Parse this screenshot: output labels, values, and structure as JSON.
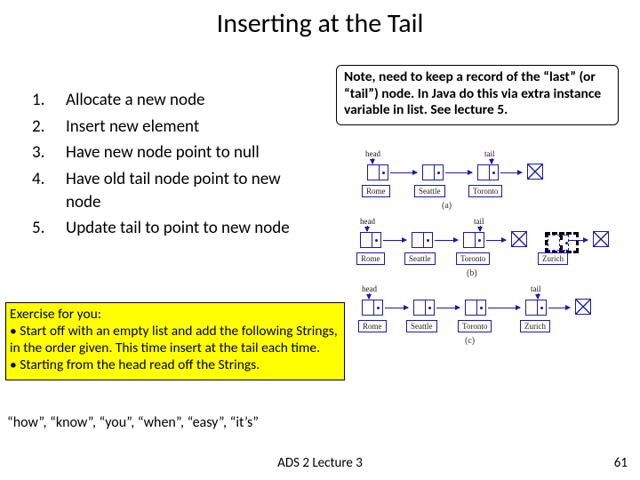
{
  "title": "Inserting at the Tail",
  "steps": [
    {
      "n": "1.",
      "t": "Allocate a new node"
    },
    {
      "n": "2.",
      "t": "Insert new element"
    },
    {
      "n": "3.",
      "t": "Have new node point to null"
    },
    {
      "n": "4.",
      "t": "Have old tail node point to new node"
    },
    {
      "n": "5.",
      "t": "Update tail to point to new node"
    }
  ],
  "note": "Note, need to keep a record of the “last” (or “tail”) node. In Java do this via extra instance variable in list. See lecture 5.",
  "labels": {
    "head": "head",
    "tail": "tail"
  },
  "cities": {
    "rome": "Rome",
    "seattle": "Seattle",
    "toronto": "Toronto",
    "zurich": "Zurich"
  },
  "diagram_letters": {
    "a": "(a)",
    "b": "(b)",
    "c": "(c)"
  },
  "exercise": {
    "heading": "Exercise for you:",
    "b1": "• Start off with an empty list and add the following  Strings, in the order given. This time insert at the tail each time.",
    "b2": "• Starting from the head read off the Strings."
  },
  "strings": "“how”, “know”, “you”, “when”, “easy”, “it’s”",
  "footer": "ADS 2 Lecture 3",
  "page": "61"
}
